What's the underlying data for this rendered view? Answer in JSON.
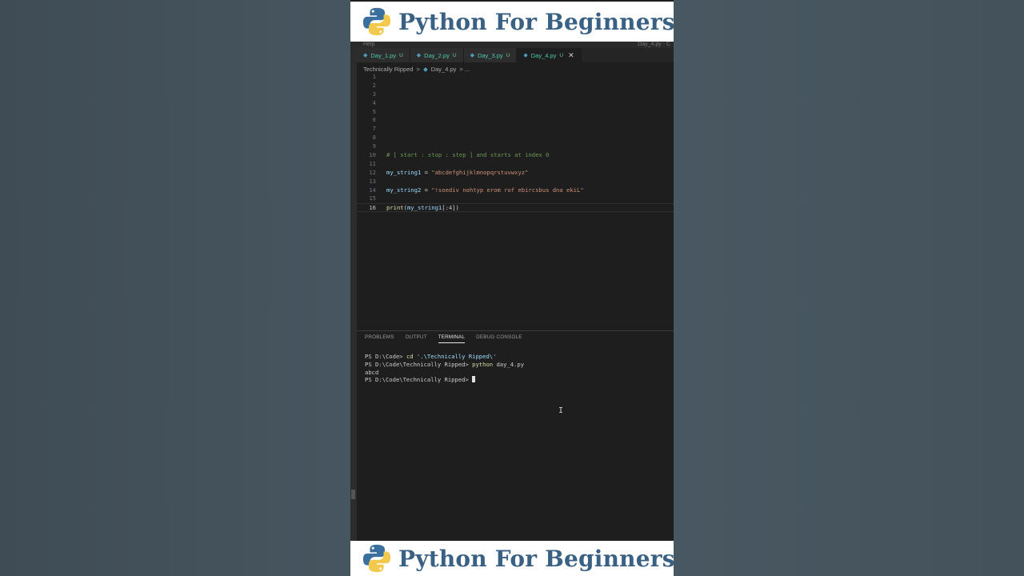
{
  "banner": {
    "title": "Python For Beginners"
  },
  "menu": {
    "help_label": "Help",
    "right_label": "Day_4.py - C"
  },
  "tabs": [
    {
      "name": "Day_1.py",
      "status": "U"
    },
    {
      "name": "Day_2.py",
      "status": "U"
    },
    {
      "name": "Day_3.py",
      "status": "U"
    },
    {
      "name": "Day_4.py",
      "status": "U",
      "active": true
    }
  ],
  "breadcrumb": {
    "folder": "Technically Ripped",
    "sep": ">",
    "file": "Day_4.py",
    "more": "> ..."
  },
  "editor": {
    "current_line": 16,
    "lines": [
      {
        "n": "1",
        "parts": []
      },
      {
        "n": "2",
        "parts": []
      },
      {
        "n": "3",
        "parts": []
      },
      {
        "n": "4",
        "parts": []
      },
      {
        "n": "5",
        "parts": []
      },
      {
        "n": "6",
        "parts": []
      },
      {
        "n": "7",
        "parts": []
      },
      {
        "n": "8",
        "parts": []
      },
      {
        "n": "9",
        "parts": []
      },
      {
        "n": "10",
        "parts": [
          {
            "t": "# [ start : stop : step ] and starts at index 0",
            "c": "cmt"
          }
        ]
      },
      {
        "n": "11",
        "parts": []
      },
      {
        "n": "12",
        "parts": [
          {
            "t": "my_string1",
            "c": "var"
          },
          {
            "t": " = ",
            "c": "op"
          },
          {
            "t": "\"abcdefghijklmnopqrstuvwxyz\"",
            "c": "str"
          }
        ]
      },
      {
        "n": "13",
        "parts": []
      },
      {
        "n": "14",
        "parts": [
          {
            "t": "my_string2",
            "c": "var"
          },
          {
            "t": " = ",
            "c": "op"
          },
          {
            "t": "\"!soediv nohtyp erom rof ebircsbus dna ekiL\"",
            "c": "str"
          }
        ]
      },
      {
        "n": "15",
        "parts": []
      },
      {
        "n": "16",
        "parts": [
          {
            "t": "print",
            "c": "fn"
          },
          {
            "t": "(",
            "c": "op"
          },
          {
            "t": "my_string1",
            "c": "var"
          },
          {
            "t": "[:",
            "c": "op"
          },
          {
            "t": "4",
            "c": "num"
          },
          {
            "t": "])",
            "c": "op"
          }
        ]
      }
    ]
  },
  "panel": {
    "tabs": [
      {
        "label": "PROBLEMS"
      },
      {
        "label": "OUTPUT"
      },
      {
        "label": "TERMINAL",
        "active": true
      },
      {
        "label": "DEBUG CONSOLE"
      }
    ]
  },
  "terminal": {
    "lines": [
      {
        "parts": [
          {
            "t": "PS D:\\Code> ",
            "c": ""
          },
          {
            "t": "cd",
            "c": "cmd"
          },
          {
            "t": " '.\\Technically Ripped\\'",
            "c": "arg"
          }
        ]
      },
      {
        "parts": [
          {
            "t": "PS D:\\Code\\Technically Ripped> ",
            "c": ""
          },
          {
            "t": "python",
            "c": "cmd"
          },
          {
            "t": " day_4.py",
            "c": ""
          }
        ]
      },
      {
        "parts": [
          {
            "t": "abcd",
            "c": ""
          }
        ]
      },
      {
        "parts": [
          {
            "t": "PS D:\\Code\\Technically Ripped> ",
            "c": ""
          }
        ],
        "cursor": true
      }
    ]
  },
  "colors": {
    "banner_text": "#3a6184",
    "editor_bg": "#1e1e1e",
    "tab_text": "#4ec9b0",
    "comment": "#6a9955",
    "string": "#ce9178",
    "variable": "#9cdcfe"
  }
}
